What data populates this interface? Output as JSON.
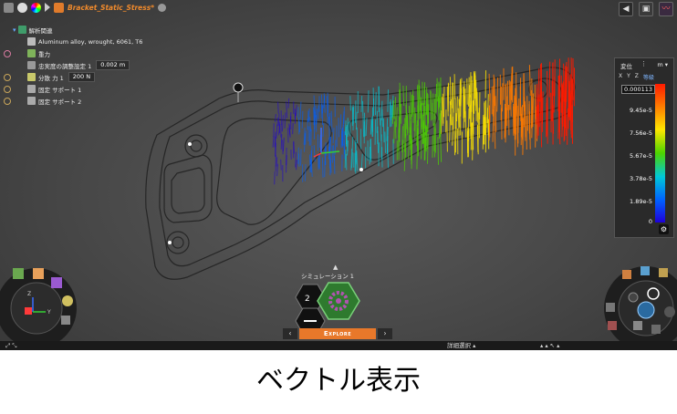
{
  "app": {
    "document_title": "Bracket_Static_Stress*",
    "simulation_label": "シミュレーション 1",
    "mode_label": "Explore",
    "bottom_label": "詳細選択 ▴"
  },
  "tree": {
    "root": "解析関連",
    "material": "Aluminum alloy, wrought, 6061, T6",
    "gravity": "重力",
    "fidelity_label": "忠実度の調整設定 1",
    "fidelity_value": "0.002 m",
    "force_label": "分散 力 1",
    "force_value": "200 N",
    "support1": "固定 サポート 1",
    "support2": "固定 サポート 2"
  },
  "legend": {
    "title": "変位",
    "unit": "m",
    "axes": [
      "X",
      "Y",
      "Z",
      "等級"
    ],
    "labels": [
      "0.000113",
      "9.45e-5",
      "7.56e-5",
      "5.67e-5",
      "3.78e-5",
      "1.89e-5",
      "0"
    ],
    "gradient": [
      "#ff1a00",
      "#ff7a00",
      "#ffe600",
      "#4cd400",
      "#00c8d8",
      "#0060ff",
      "#1f00d8"
    ]
  },
  "caption": "ベクトル表示",
  "colors": {
    "accent": "#f08a2c",
    "hex_active": "#3a8a3a",
    "gear": "#a04aa0"
  }
}
